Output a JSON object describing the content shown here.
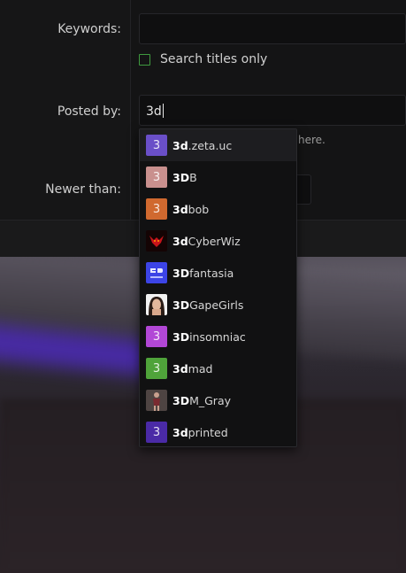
{
  "form": {
    "keywords_label": "Keywords:",
    "search_titles_only_label": "Search titles only",
    "posted_by_label": "Posted by:",
    "posted_by_value": "3d",
    "posted_by_hint": "here.",
    "newer_than_label": "Newer than:"
  },
  "dropdown": {
    "match": "3d",
    "items": [
      {
        "bold": "3d",
        "rest": ".zeta.uc",
        "avatar_letter": "3",
        "avatar_color": "#6a4fc8",
        "active": true
      },
      {
        "bold": "3D",
        "rest": "B",
        "avatar_letter": "3",
        "avatar_color": "#c9908e"
      },
      {
        "bold": "3d",
        "rest": "bob",
        "avatar_letter": "3",
        "avatar_color": "#d0692f"
      },
      {
        "bold": "3d",
        "rest": "CyberWiz",
        "avatar_icon": "red-creature-icon",
        "avatar_color": "#1a0505"
      },
      {
        "bold": "3D",
        "rest": "fantasia",
        "avatar_icon": "3d-logo-icon",
        "avatar_color": "#3c44e6"
      },
      {
        "bold": "3D",
        "rest": "GapeGirls",
        "avatar_icon": "face-photo-icon",
        "avatar_color": "#f0f0f0"
      },
      {
        "bold": "3D",
        "rest": "insomniac",
        "avatar_letter": "3",
        "avatar_color": "#b247d6"
      },
      {
        "bold": "3d",
        "rest": "mad",
        "avatar_letter": "3",
        "avatar_color": "#4fa33a"
      },
      {
        "bold": "3D",
        "rest": "M_Gray",
        "avatar_icon": "figure-photo-icon",
        "avatar_color": "#5a4a48"
      },
      {
        "bold": "3d",
        "rest": "printed",
        "avatar_letter": "3",
        "avatar_color": "#4a2aa6"
      }
    ]
  }
}
